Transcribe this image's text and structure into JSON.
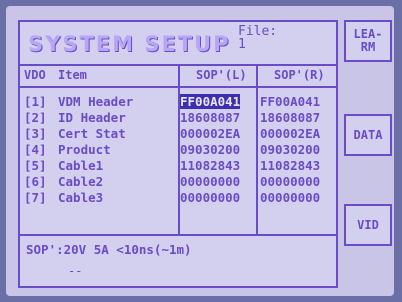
{
  "title": "SYSTEM SETUP",
  "file_label": "File:",
  "file_value": "1",
  "columns": {
    "vdo": "VDO",
    "item": "Item",
    "sop_l": "SOP'(L)",
    "sop_r": "SOP'(R)"
  },
  "rows": [
    {
      "idx": "[1]",
      "item": "VDM Header",
      "left": "FF00A041",
      "right": "FF00A041"
    },
    {
      "idx": "[2]",
      "item": "ID Header",
      "left": "18608087",
      "right": "18608087"
    },
    {
      "idx": "[3]",
      "item": "Cert Stat",
      "left": "000002EA",
      "right": "000002EA"
    },
    {
      "idx": "[4]",
      "item": "Product",
      "left": "09030200",
      "right": "09030200"
    },
    {
      "idx": "[5]",
      "item": "Cable1",
      "left": "11082843",
      "right": "11082843"
    },
    {
      "idx": "[6]",
      "item": "Cable2",
      "left": "00000000",
      "right": "00000000"
    },
    {
      "idx": "[7]",
      "item": "Cable3",
      "left": "00000000",
      "right": "00000000"
    }
  ],
  "status": "SOP':20V 5A <10ns(~1m)",
  "status_sub": "--",
  "softkeys": {
    "learn": "LEA-\nRM",
    "data": "DATA",
    "vid": "VID"
  }
}
